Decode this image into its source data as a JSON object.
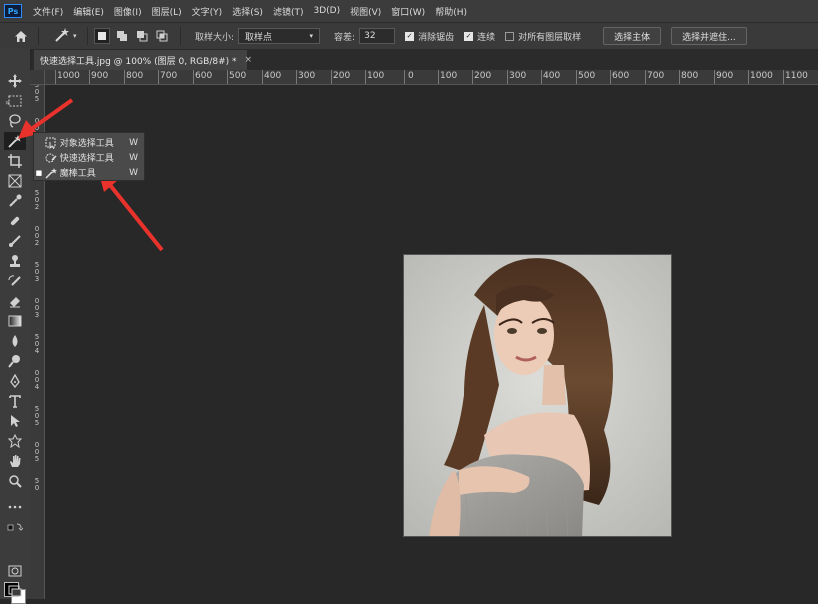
{
  "app": {
    "logo": "Ps"
  },
  "menu": [
    "文件(F)",
    "编辑(E)",
    "图像(I)",
    "图层(L)",
    "文字(Y)",
    "选择(S)",
    "滤镜(T)",
    "3D(D)",
    "视图(V)",
    "窗口(W)",
    "帮助(H)"
  ],
  "options": {
    "sample_size_label": "取样大小:",
    "sample_size_value": "取样点",
    "tolerance_label": "容差:",
    "tolerance_value": "32",
    "anti_alias_label": "消除锯齿",
    "anti_alias_checked": true,
    "contiguous_label": "连续",
    "contiguous_checked": true,
    "sample_all_layers_label": "对所有图层取样",
    "sample_all_layers_checked": false,
    "select_subject_label": "选择主体",
    "select_mask_label": "选择并遮住..."
  },
  "document": {
    "tab_title": "快速选择工具.jpg @ 100% (图层 0, RGB/8#) *",
    "close_glyph": "×"
  },
  "toolbar": {
    "collapse_glyph": "»"
  },
  "ruler": {
    "h_labels": [
      "1000",
      "900",
      "800",
      "700",
      "600",
      "500",
      "400",
      "300",
      "200",
      "100",
      "0",
      "100",
      "200",
      "300",
      "400",
      "500",
      "600",
      "700",
      "800",
      "900",
      "1000",
      "1100"
    ],
    "v_labels": [
      "5",
      "0",
      "5",
      "0",
      "0",
      "1",
      "0",
      "0",
      "1",
      "5",
      "0",
      "2",
      "0",
      "0",
      "2",
      "5",
      "0",
      "3",
      "0",
      "0",
      "3",
      "5",
      "0",
      "4",
      "0",
      "0",
      "4",
      "5",
      "0",
      "5",
      "0",
      "0",
      "5",
      "5",
      "0"
    ]
  },
  "flyout": {
    "items": [
      {
        "label": "对象选择工具",
        "key": "W",
        "icon": "object-selection-icon",
        "active": false
      },
      {
        "label": "快速选择工具",
        "key": "W",
        "icon": "quick-selection-icon",
        "active": false
      },
      {
        "label": "魔棒工具",
        "key": "W",
        "icon": "magic-wand-icon",
        "active": true
      }
    ]
  },
  "colors": {
    "canvas_bg": "#282828",
    "panel_bg": "#3c3c3c",
    "annotation_arrow": "#e8322b"
  }
}
